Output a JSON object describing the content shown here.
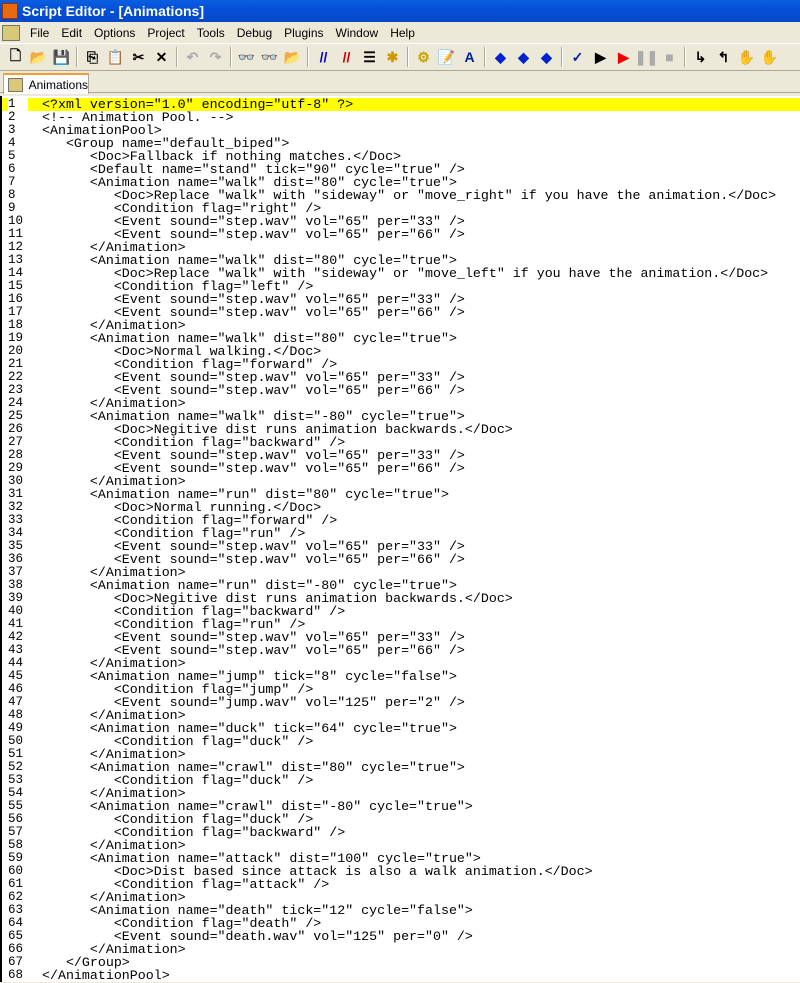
{
  "window": {
    "title": "Script Editor - [Animations]"
  },
  "menu": [
    "File",
    "Edit",
    "Options",
    "Project",
    "Tools",
    "Debug",
    "Plugins",
    "Window",
    "Help"
  ],
  "toolbar": [
    {
      "icon": "new-file-icon",
      "g": "🗋"
    },
    {
      "icon": "open-folder-icon",
      "g": "📂"
    },
    {
      "icon": "save-icon",
      "g": "💾"
    },
    "|",
    {
      "icon": "copy-icon",
      "g": "⎘"
    },
    {
      "icon": "paste-icon",
      "g": "📋",
      "disabled": true
    },
    {
      "icon": "cut-icon",
      "g": "✂"
    },
    {
      "icon": "delete-icon",
      "g": "✕"
    },
    "|",
    {
      "icon": "undo-icon",
      "g": "↶",
      "disabled": true
    },
    {
      "icon": "redo-icon",
      "g": "↷",
      "disabled": true
    },
    "|",
    {
      "icon": "find-icon",
      "g": "👓"
    },
    {
      "icon": "find-next-icon",
      "g": "👓",
      "disabled": true
    },
    {
      "icon": "find-in-files-icon",
      "g": "📂"
    },
    "|",
    {
      "icon": "comment-icon",
      "g": "//",
      "color": "#0000cc"
    },
    {
      "icon": "uncomment-icon",
      "g": "//",
      "color": "#cc0000"
    },
    {
      "icon": "indent-icon",
      "g": "☰"
    },
    {
      "icon": "new-item-icon",
      "g": "✱",
      "color": "#c90"
    },
    "|",
    {
      "icon": "settings-icon",
      "g": "⚙",
      "color": "#c9a000"
    },
    {
      "icon": "properties-icon",
      "g": "📝"
    },
    {
      "icon": "font-icon",
      "g": "A",
      "color": "#002299"
    },
    "|",
    {
      "icon": "toggle-bookmark-icon",
      "g": "◆",
      "color": "#0022cc"
    },
    {
      "icon": "next-bookmark-icon",
      "g": "◆",
      "color": "#0022cc"
    },
    {
      "icon": "prev-bookmark-icon",
      "g": "◆",
      "color": "#0022cc"
    },
    "|",
    {
      "icon": "spell-check-icon",
      "g": "✓",
      "color": "#0022aa"
    },
    {
      "icon": "run-icon",
      "g": "▶"
    },
    {
      "icon": "debug-run-icon",
      "g": "▶",
      "color": "#ee0000"
    },
    {
      "icon": "pause-icon",
      "g": "❚❚",
      "disabled": true
    },
    {
      "icon": "stop-icon",
      "g": "■",
      "disabled": true
    },
    "|",
    {
      "icon": "step-into-icon",
      "g": "↳"
    },
    {
      "icon": "step-out-icon",
      "g": "↰"
    },
    {
      "icon": "hand-icon",
      "g": "✋"
    },
    {
      "icon": "hand-disabled-icon",
      "g": "✋",
      "disabled": true
    }
  ],
  "tab": {
    "label": "Animations"
  },
  "editor": {
    "highlight_line": 1,
    "lines": [
      "<?xml version=\"1.0\" encoding=\"utf-8\" ?>",
      "<!-- Animation Pool. -->",
      "<AnimationPool>",
      "   <Group name=\"default_biped\">",
      "      <Doc>Fallback if nothing matches.</Doc>",
      "      <Default name=\"stand\" tick=\"90\" cycle=\"true\" />",
      "      <Animation name=\"walk\" dist=\"80\" cycle=\"true\">",
      "         <Doc>Replace \"walk\" with \"sideway\" or \"move_right\" if you have the animation.</Doc>",
      "         <Condition flag=\"right\" />",
      "         <Event sound=\"step.wav\" vol=\"65\" per=\"33\" />",
      "         <Event sound=\"step.wav\" vol=\"65\" per=\"66\" />",
      "      </Animation>",
      "      <Animation name=\"walk\" dist=\"80\" cycle=\"true\">",
      "         <Doc>Replace \"walk\" with \"sideway\" or \"move_left\" if you have the animation.</Doc>",
      "         <Condition flag=\"left\" />",
      "         <Event sound=\"step.wav\" vol=\"65\" per=\"33\" />",
      "         <Event sound=\"step.wav\" vol=\"65\" per=\"66\" />",
      "      </Animation>",
      "      <Animation name=\"walk\" dist=\"80\" cycle=\"true\">",
      "         <Doc>Normal walking.</Doc>",
      "         <Condition flag=\"forward\" />",
      "         <Event sound=\"step.wav\" vol=\"65\" per=\"33\" />",
      "         <Event sound=\"step.wav\" vol=\"65\" per=\"66\" />",
      "      </Animation>",
      "      <Animation name=\"walk\" dist=\"-80\" cycle=\"true\">",
      "         <Doc>Negitive dist runs animation backwards.</Doc>",
      "         <Condition flag=\"backward\" />",
      "         <Event sound=\"step.wav\" vol=\"65\" per=\"33\" />",
      "         <Event sound=\"step.wav\" vol=\"65\" per=\"66\" />",
      "      </Animation>",
      "      <Animation name=\"run\" dist=\"80\" cycle=\"true\">",
      "         <Doc>Normal running.</Doc>",
      "         <Condition flag=\"forward\" />",
      "         <Condition flag=\"run\" />",
      "         <Event sound=\"step.wav\" vol=\"65\" per=\"33\" />",
      "         <Event sound=\"step.wav\" vol=\"65\" per=\"66\" />",
      "      </Animation>",
      "      <Animation name=\"run\" dist=\"-80\" cycle=\"true\">",
      "         <Doc>Negitive dist runs animation backwards.</Doc>",
      "         <Condition flag=\"backward\" />",
      "         <Condition flag=\"run\" />",
      "         <Event sound=\"step.wav\" vol=\"65\" per=\"33\" />",
      "         <Event sound=\"step.wav\" vol=\"65\" per=\"66\" />",
      "      </Animation>",
      "      <Animation name=\"jump\" tick=\"8\" cycle=\"false\">",
      "         <Condition flag=\"jump\" />",
      "         <Event sound=\"jump.wav\" vol=\"125\" per=\"2\" />",
      "      </Animation>",
      "      <Animation name=\"duck\" tick=\"64\" cycle=\"true\">",
      "         <Condition flag=\"duck\" />",
      "      </Animation>",
      "      <Animation name=\"crawl\" dist=\"80\" cycle=\"true\">",
      "         <Condition flag=\"duck\" />",
      "      </Animation>",
      "      <Animation name=\"crawl\" dist=\"-80\" cycle=\"true\">",
      "         <Condition flag=\"duck\" />",
      "         <Condition flag=\"backward\" />",
      "      </Animation>",
      "      <Animation name=\"attack\" dist=\"100\" cycle=\"true\">",
      "         <Doc>Dist based since attack is also a walk animation.</Doc>",
      "         <Condition flag=\"attack\" />",
      "      </Animation>",
      "      <Animation name=\"death\" tick=\"12\" cycle=\"false\">",
      "         <Condition flag=\"death\" />",
      "         <Event sound=\"death.wav\" vol=\"125\" per=\"0\" />",
      "      </Animation>",
      "   </Group>",
      "</AnimationPool>"
    ]
  }
}
